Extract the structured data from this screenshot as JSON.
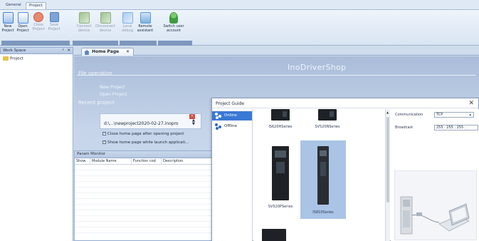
{
  "ribbon": {
    "tabs": [
      "General",
      "Project"
    ],
    "active_tab": "Project",
    "buttons": [
      {
        "label": "New\nProject",
        "icon": "new-project-icon",
        "color": "#3f7fd0",
        "enabled": true
      },
      {
        "label": "Open\nProject",
        "icon": "open-project-icon",
        "color": "#4d8ad8",
        "enabled": true
      },
      {
        "label": "Close\nProject",
        "icon": "close-project-icon",
        "color": "#e06040",
        "enabled": false
      },
      {
        "label": "Save\nProject",
        "icon": "save-project-icon",
        "color": "#4a7cc6",
        "enabled": false
      },
      {
        "label": "Connect\ndevice",
        "icon": "connect-device-icon",
        "color": "#69a15a",
        "enabled": false
      },
      {
        "label": "Disconnect\ndevice",
        "icon": "disconnect-device-icon",
        "color": "#69a15a",
        "enabled": false
      },
      {
        "label": "Local\ndebug",
        "icon": "local-debug-icon",
        "color": "#5b9bd8",
        "enabled": false
      },
      {
        "label": "Remote\nassistant",
        "icon": "remote-assistant-icon",
        "color": "#5b9bd8",
        "enabled": true
      },
      {
        "label": "Switch user\naccount",
        "icon": "switch-user-icon",
        "color": "#3f9b3f",
        "enabled": true
      }
    ]
  },
  "workspace": {
    "title": "Work Space",
    "pin": "ᵖ",
    "close": "✕",
    "tree": [
      "Project"
    ]
  },
  "home_tab": {
    "label": "Home Page",
    "close": "✕"
  },
  "home": {
    "brand": "InoDriverShop",
    "file_operation_title": "File operation",
    "new_project": "New Project",
    "open_project": "Open Project",
    "recent_title": "Recent project",
    "recent_path": "d:\\...\\newproject2020-02-27.inopro",
    "remove_glyph": "✕",
    "spin_up": "▲",
    "spin_down": "▼",
    "check_close_home": "Close home page after opening project",
    "check_show_home": "Show home page while launch applicati..."
  },
  "param_monitor": {
    "title": "Param Monitor",
    "columns": [
      "Show",
      "Module Name",
      "Function cod",
      "Description"
    ]
  },
  "guide": {
    "title": "Project Guide",
    "close": "✕",
    "nav": [
      {
        "label": "Online",
        "selected": true
      },
      {
        "label": "Offline",
        "selected": false
      }
    ],
    "products": [
      "IS620HSeries",
      "SV520NSeries",
      "SV520PSeries",
      "IS810Series"
    ],
    "selected_product": "IS810Series",
    "communication_label": "Communication",
    "communication_value": "TCP",
    "broadcast_label": "Broadcast",
    "broadcast_value": "255 . 255 . 255 .",
    "accent": "#3a79d4"
  }
}
